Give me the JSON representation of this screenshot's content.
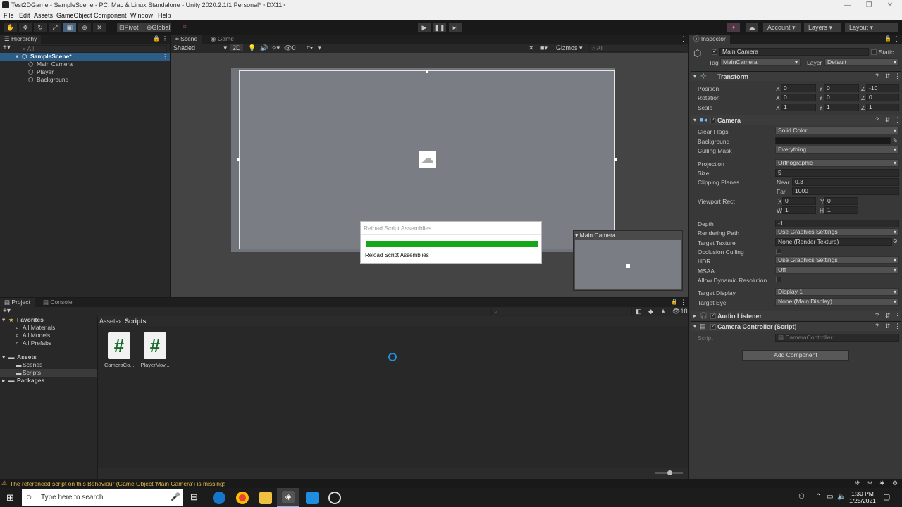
{
  "window": {
    "title": "Test2DGame - SampleScene - PC, Mac & Linux Standalone - Unity 2020.2.1f1 Personal* <DX11>",
    "minimize": "—",
    "restore": "❐",
    "close": "✕"
  },
  "menu": [
    "File",
    "Edit",
    "Assets",
    "GameObject",
    "Component",
    "Window",
    "Help"
  ],
  "toolbar": {
    "pivot": "Pivot",
    "global": "Global",
    "account": "Account",
    "layers": "Layers",
    "layout": "Layout"
  },
  "hierarchy": {
    "tab": "Hierarchy",
    "search_placeholder": "All",
    "scene": "SampleScene*",
    "items": [
      "Main Camera",
      "Player",
      "Background"
    ]
  },
  "scene": {
    "tab_scene": "Scene",
    "tab_game": "Game",
    "shading": "Shaded",
    "mode_2d": "2D",
    "fx_count": "0",
    "gizmos": "Gizmos",
    "search_placeholder": "All"
  },
  "dialog": {
    "title": "Reload Script Assemblies",
    "progress": 1.0,
    "message": "Reload Script Assemblies"
  },
  "camera_preview": {
    "title": "Main Camera"
  },
  "project": {
    "tab_project": "Project",
    "tab_console": "Console",
    "hidden_count": "18",
    "tree": {
      "favorites": "Favorites",
      "favorites_items": [
        "All Materials",
        "All Models",
        "All Prefabs"
      ],
      "assets": "Assets",
      "assets_items": [
        "Scenes",
        "Scripts"
      ],
      "packages": "Packages"
    },
    "breadcrumb": [
      "Assets",
      "Scripts"
    ],
    "files": [
      "CameraCo...",
      "PlayerMov..."
    ],
    "file_glyph": "#"
  },
  "inspector": {
    "tab": "Inspector",
    "object_name": "Main Camera",
    "static_label": "Static",
    "tag_label": "Tag",
    "tag_value": "MainCamera",
    "layer_label": "Layer",
    "layer_value": "Default",
    "transform": {
      "title": "Transform",
      "rows": [
        {
          "label": "Position",
          "x": "0",
          "y": "0",
          "z": "-10"
        },
        {
          "label": "Rotation",
          "x": "0",
          "y": "0",
          "z": "0"
        },
        {
          "label": "Scale",
          "x": "1",
          "y": "1",
          "z": "1"
        }
      ]
    },
    "camera": {
      "title": "Camera",
      "clear_flags_label": "Clear Flags",
      "clear_flags": "Solid Color",
      "background_label": "Background",
      "background_color": "#1a1a1a",
      "culling_label": "Culling Mask",
      "culling": "Everything",
      "projection_label": "Projection",
      "projection": "Orthographic",
      "size_label": "Size",
      "size": "5",
      "clipping_label": "Clipping Planes",
      "near_label": "Near",
      "near": "0.3",
      "far_label": "Far",
      "far": "1000",
      "viewport_label": "Viewport Rect",
      "vx": "0",
      "vy": "0",
      "vw": "1",
      "vh": "1",
      "depth_label": "Depth",
      "depth": "-1",
      "render_path_label": "Rendering Path",
      "render_path": "Use Graphics Settings",
      "target_texture_label": "Target Texture",
      "target_texture": "None (Render Texture)",
      "occlusion_label": "Occlusion Culling",
      "hdr_label": "HDR",
      "hdr": "Use Graphics Settings",
      "msaa_label": "MSAA",
      "msaa": "Off",
      "dyn_res_label": "Allow Dynamic Resolution",
      "target_display_label": "Target Display",
      "target_display": "Display 1",
      "target_eye_label": "Target Eye",
      "target_eye": "None (Main Display)"
    },
    "audio_listener": "Audio Listener",
    "camera_controller": {
      "title": "Camera Controller (Script)",
      "script_label": "Script",
      "script_value": "CameraController"
    },
    "add_component": "Add Component"
  },
  "status": {
    "warning": "The referenced script on this Behaviour (Game Object 'Main Camera') is missing!"
  },
  "taskbar": {
    "search_placeholder": "Type here to search",
    "time": "1:30 PM",
    "date": "1/25/2021"
  },
  "colors": {
    "accent_blue": "#2c5d87",
    "progress_green": "#16a81a",
    "warning_yellow": "#e0b84a"
  }
}
